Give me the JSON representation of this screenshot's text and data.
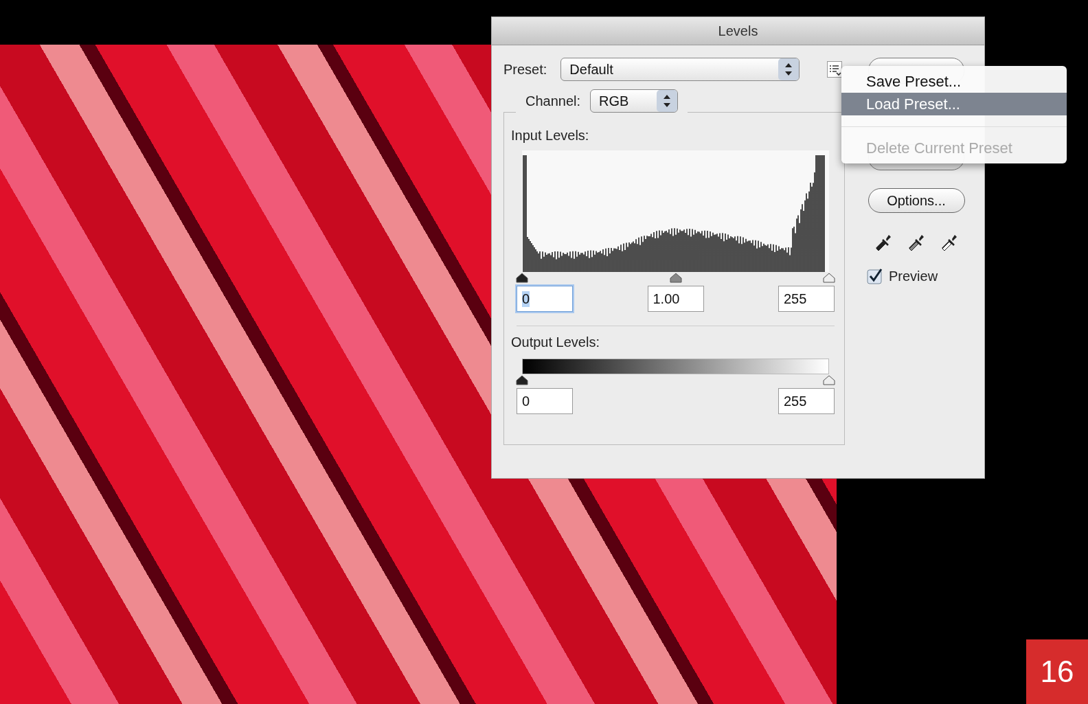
{
  "dialog": {
    "title": "Levels",
    "preset": {
      "label": "Preset:",
      "value": "Default"
    },
    "preset_menu": {
      "items": [
        {
          "label": "Save Preset...",
          "selected": false,
          "disabled": false,
          "separator_before": false
        },
        {
          "label": "Load Preset...",
          "selected": true,
          "disabled": false,
          "separator_before": false
        },
        {
          "label": "Delete Current Preset",
          "selected": false,
          "disabled": true,
          "separator_before": true
        }
      ]
    },
    "channel": {
      "label": "Channel:",
      "value": "RGB"
    },
    "input_levels": {
      "label": "Input Levels:",
      "thumbs": [
        {
          "level": 0
        },
        {
          "level": 0.5
        },
        {
          "level": 1
        }
      ],
      "fields": [
        {
          "value": "0",
          "selected": true
        },
        {
          "value": "1.00",
          "selected": false
        },
        {
          "value": "255",
          "selected": false
        }
      ]
    },
    "output_levels": {
      "label": "Output Levels:",
      "thumbs": [
        {
          "level": 0
        },
        {
          "level": 1
        }
      ],
      "fields": [
        {
          "value": "0",
          "selected": false
        },
        {
          "value": "255",
          "selected": false
        }
      ]
    },
    "options_button": "Options...",
    "preview": {
      "label": "Preview",
      "checked": true
    }
  },
  "page_number": "16"
}
